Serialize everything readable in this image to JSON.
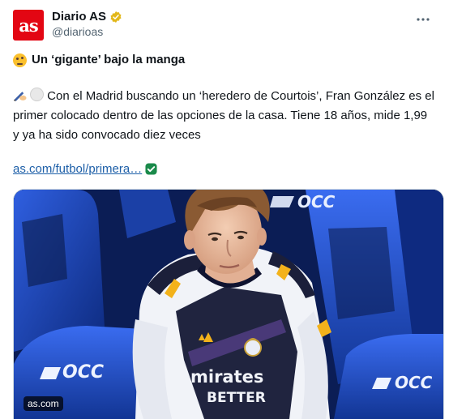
{
  "account": {
    "display_name": "Diario AS",
    "handle": "@diarioas",
    "avatar_text": "as"
  },
  "tweet": {
    "headline": "Un ‘gigante’ bajo la manga",
    "headline_emoji": "thinking-face-icon",
    "body": "Con el Madrid buscando un ‘heredero de Courtois’, Fran González es el primer colocado dentro de las opciones de la casa. Tiene 18 años, mide 1,99 y ya ha sido convocado diez veces",
    "body_emojis": [
      "writing-hand-icon",
      "white-circle-icon"
    ],
    "link_text": "as.com/futbol/primera…"
  },
  "media": {
    "seat_brand": "OCC",
    "shirt_text_line1": "mirates",
    "shirt_text_line2": "BETTER",
    "source_label": "as.com"
  },
  "colors": {
    "brand_red": "#e30613",
    "verified_gold": "#e2b719",
    "link_blue": "#1d5fa8",
    "check_green": "#1a8a4a",
    "seat_blue": "#2450c8"
  }
}
